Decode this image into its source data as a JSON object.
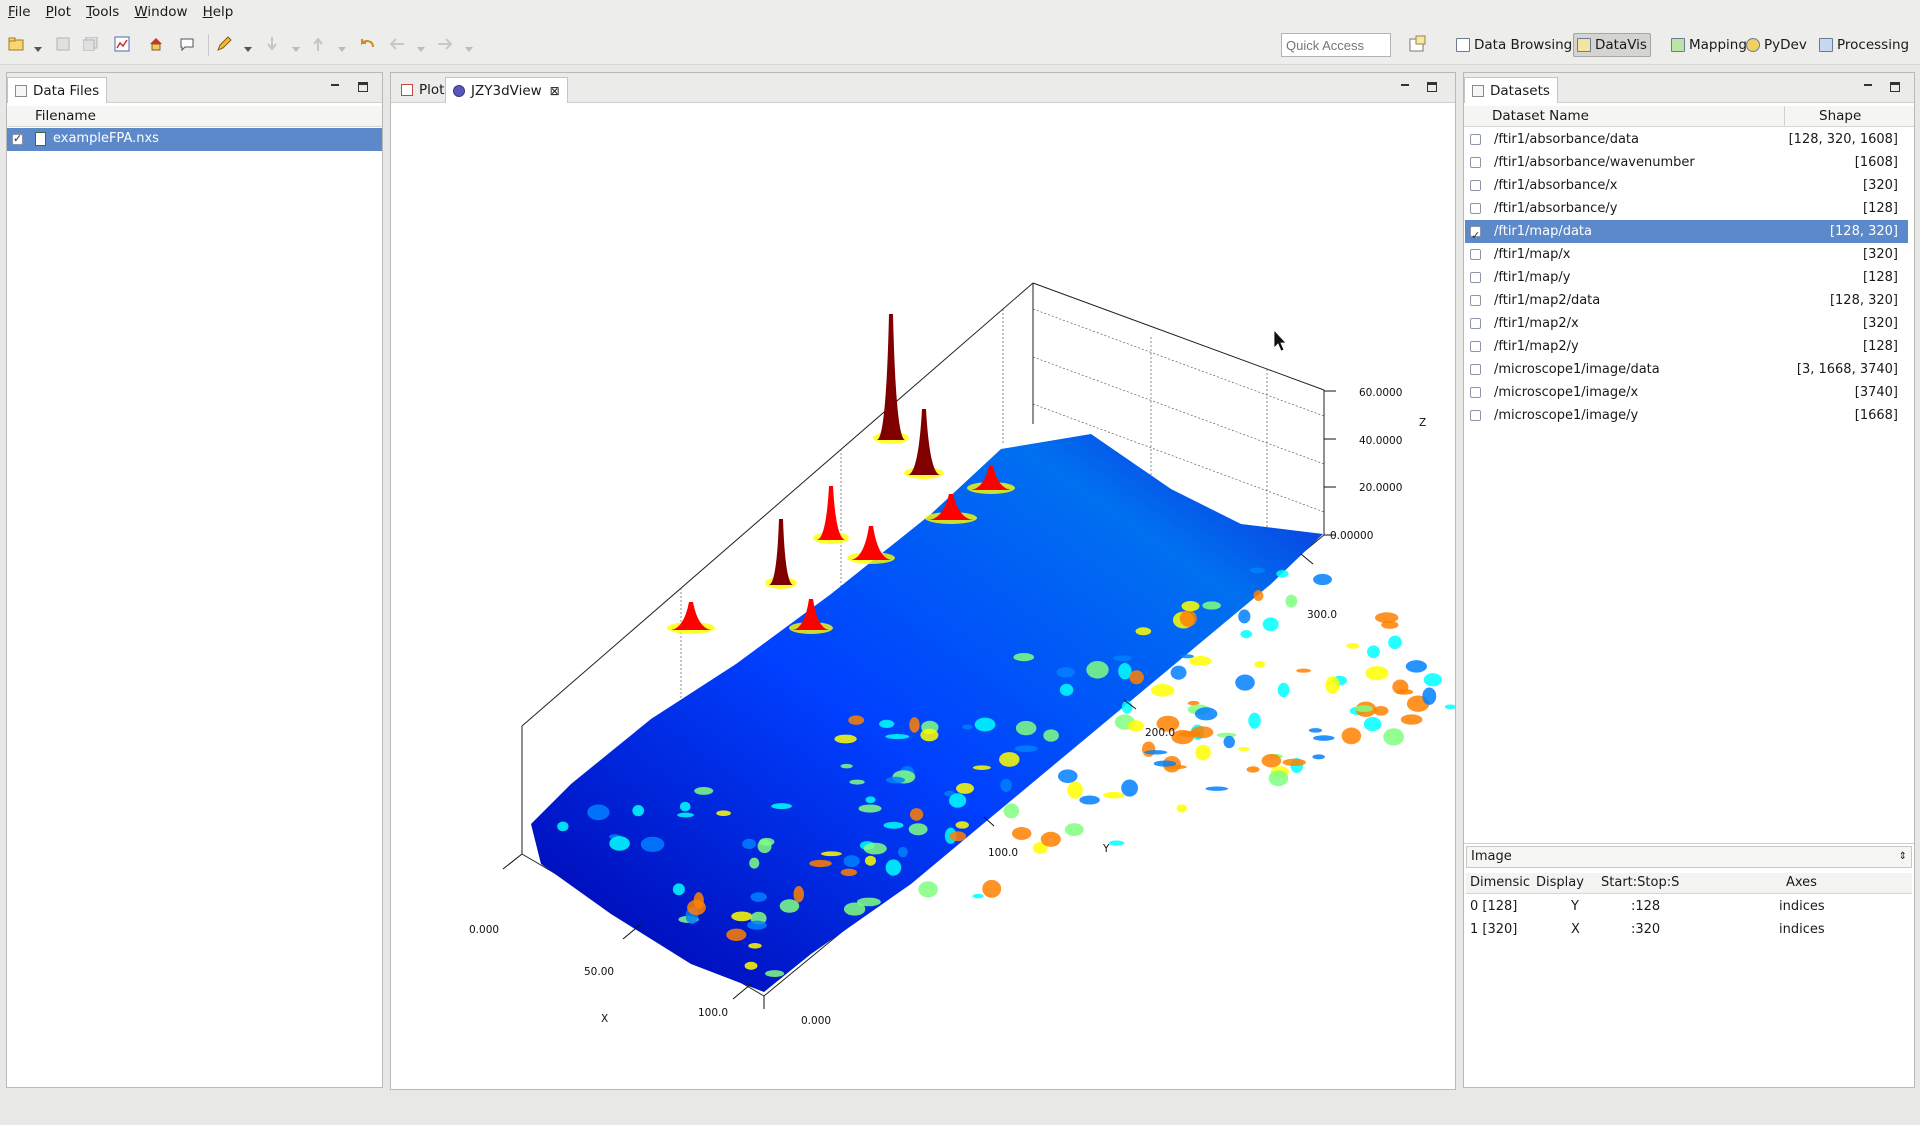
{
  "menubar": {
    "items": [
      {
        "label": "File",
        "mnemonic": "F",
        "rest": "ile"
      },
      {
        "label": "Plot",
        "mnemonic": "P",
        "rest": "lot"
      },
      {
        "label": "Tools",
        "mnemonic": "T",
        "rest": "ools"
      },
      {
        "label": "Window",
        "mnemonic": "W",
        "rest": "indow"
      },
      {
        "label": "Help",
        "mnemonic": "H",
        "rest": "elp"
      }
    ]
  },
  "toolbar": {
    "quick_access_placeholder": "Quick Access",
    "perspectives": [
      {
        "label": "Data Browsing",
        "active": false
      },
      {
        "label": "DataVis",
        "active": true
      },
      {
        "label": "Mapping",
        "active": false
      },
      {
        "label": "PyDev",
        "active": false
      },
      {
        "label": "Processing",
        "active": false
      }
    ]
  },
  "data_files": {
    "tab_label": "Data Files",
    "column_filename": "Filename",
    "files": [
      {
        "name": "exampleFPA.nxs",
        "checked": true,
        "selected": true
      }
    ]
  },
  "editor": {
    "tabs": [
      {
        "label": "Plot",
        "selected": false
      },
      {
        "label": "JZY3dView",
        "selected": true,
        "closable": true
      }
    ]
  },
  "plot3d": {
    "x_axis_label": "X",
    "y_axis_label": "Y",
    "z_axis_label": "Z",
    "x_ticks": [
      "0.000",
      "50.00",
      "100.0"
    ],
    "y_ticks": [
      "0.000",
      "100.0",
      "200.0",
      "300.0"
    ],
    "z_ticks": [
      "0.00000",
      "20.0000",
      "40.0000",
      "60.0000"
    ],
    "colormap": [
      "#00008f",
      "#0000ff",
      "#0080ff",
      "#00ffff",
      "#80ff80",
      "#ffff00",
      "#ff8000",
      "#ff0000",
      "#800000"
    ]
  },
  "datasets": {
    "tab_label": "Datasets",
    "col_name": "Dataset Name",
    "col_shape": "Shape",
    "rows": [
      {
        "name": "/ftir1/absorbance/data",
        "shape": "[128, 320, 1608]",
        "checked": false
      },
      {
        "name": "/ftir1/absorbance/wavenumber",
        "shape": "[1608]",
        "checked": false
      },
      {
        "name": "/ftir1/absorbance/x",
        "shape": "[320]",
        "checked": false
      },
      {
        "name": "/ftir1/absorbance/y",
        "shape": "[128]",
        "checked": false
      },
      {
        "name": "/ftir1/map/data",
        "shape": "[128, 320]",
        "checked": true,
        "selected": true
      },
      {
        "name": "/ftir1/map/x",
        "shape": "[320]",
        "checked": false
      },
      {
        "name": "/ftir1/map/y",
        "shape": "[128]",
        "checked": false
      },
      {
        "name": "/ftir1/map2/data",
        "shape": "[128, 320]",
        "checked": false
      },
      {
        "name": "/ftir1/map2/x",
        "shape": "[320]",
        "checked": false
      },
      {
        "name": "/ftir1/map2/y",
        "shape": "[128]",
        "checked": false
      },
      {
        "name": "/microscope1/image/data",
        "shape": "[3, 1668, 3740]",
        "checked": false
      },
      {
        "name": "/microscope1/image/x",
        "shape": "[3740]",
        "checked": false
      },
      {
        "name": "/microscope1/image/y",
        "shape": "[1668]",
        "checked": false
      }
    ]
  },
  "slice": {
    "mode_value": "Image",
    "headers": {
      "dimension": "Dimensic",
      "display": "Display",
      "range": "Start:Stop:S",
      "axes": "Axes"
    },
    "rows": [
      {
        "dimension": "0 [128]",
        "display": "Y",
        "range": ":128",
        "axes": "indices"
      },
      {
        "dimension": "1 [320]",
        "display": "X",
        "range": ":320",
        "axes": "indices"
      }
    ]
  }
}
